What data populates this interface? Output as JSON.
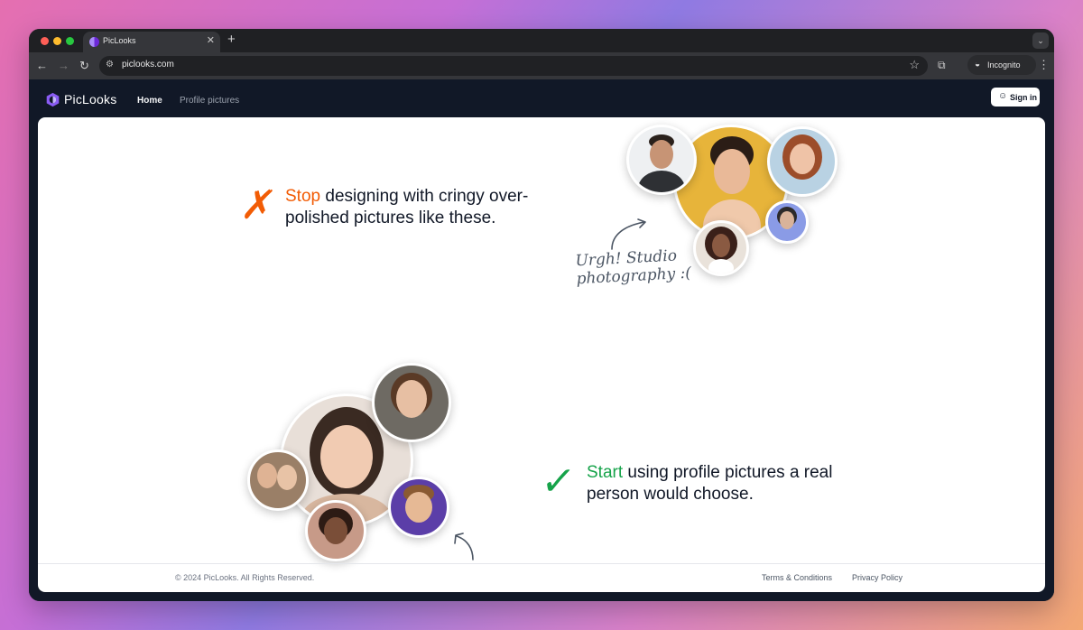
{
  "browser": {
    "tab_title": "PicLooks",
    "url": "piclooks.com",
    "incognito_label": "Incognito",
    "icons": [
      "back-icon",
      "forward-icon",
      "reload-icon",
      "site-info-icon",
      "star-icon",
      "extensions-icon",
      "incognito-icon",
      "menu-icon",
      "tab-close-icon",
      "new-tab-icon",
      "tab-dropdown-icon"
    ]
  },
  "site": {
    "brand": "PicLooks",
    "nav": {
      "home": "Home",
      "profile_pictures": "Profile pictures"
    },
    "sign_in": "Sign in"
  },
  "hero_bad": {
    "accent_word": "Stop",
    "text": " designing with cringy over-polished pictures like these.",
    "note_line1": "Urgh! Studio",
    "note_line2": "photography :("
  },
  "hero_good": {
    "accent_word": "Start",
    "text": " using profile pictures a real person would choose."
  },
  "footer": {
    "copyright": "© 2024 PicLooks. All Rights Reserved.",
    "terms": "Terms & Conditions",
    "privacy": "Privacy Policy"
  },
  "colors": {
    "accent_orange": "#f25c05",
    "accent_green": "#16a34a",
    "header_bg": "#111827",
    "brand_purple": "#8b5cf6"
  }
}
